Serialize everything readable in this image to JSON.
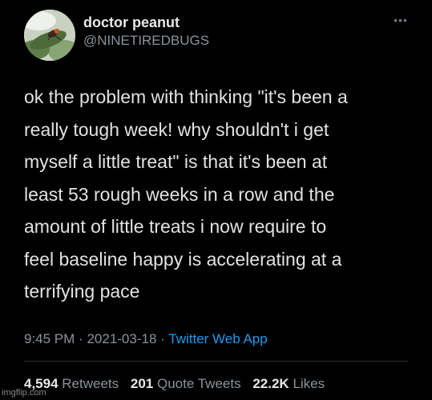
{
  "author": {
    "display_name": "doctor peanut",
    "handle": "@NINETIREDBUGS",
    "avatar_icon": "bug-on-leaf-avatar"
  },
  "more_icon": "more-horizontal-icon",
  "tweet": {
    "text": "ok the problem with thinking \"it's been a\nreally tough week! why shouldn't i get\nmyself a little treat\" is that it's been at\nleast 53 rough weeks in a row and the\namount of little treats i now require to\nfeel baseline happy is accelerating at a\nterrifying pace"
  },
  "meta": {
    "time": "9:45 PM",
    "separator": "·",
    "date": "2021-03-18",
    "app": "Twitter Web App"
  },
  "stats": {
    "retweets_count": "4,594",
    "retweets_label": "Retweets",
    "quotes_count": "201",
    "quotes_label": "Quote Tweets",
    "likes_count": "22.2K",
    "likes_label": "Likes"
  },
  "watermark": "imgflip.com",
  "colors": {
    "background": "#000000",
    "link": "#1d9bf0",
    "secondary": "#8b9399"
  }
}
